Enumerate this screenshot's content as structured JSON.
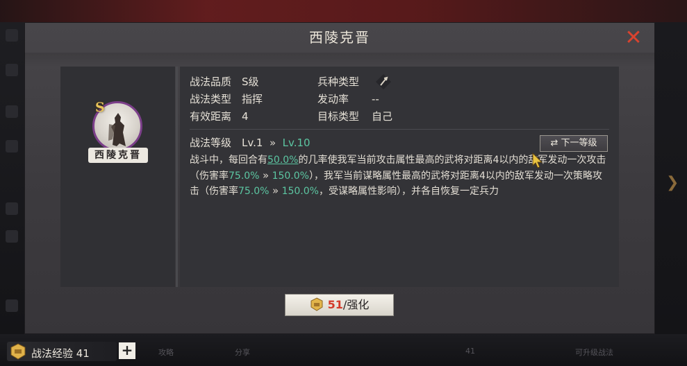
{
  "background": {
    "bottom_dim_texts": [
      "攻略",
      "分享",
      "可升级战法"
    ],
    "bottom_dim_number": "41"
  },
  "modal": {
    "title": "西陵克晋",
    "close_icon": "close-x-icon"
  },
  "tactic_card": {
    "rank": "S",
    "name": "西陵克晋",
    "border_color": "#7c3f8a"
  },
  "info": {
    "quality_label": "战法品质",
    "quality_value": "S级",
    "troop_label": "兵种类型",
    "troop_icon": "troop-type-icon",
    "type_label": "战法类型",
    "type_value": "指挥",
    "trigger_label": "发动率",
    "trigger_value": "--",
    "range_label": "有效距离",
    "range_value": "4",
    "target_label": "目标类型",
    "target_value": "自己"
  },
  "level": {
    "label": "战法等级",
    "current": "Lv.1",
    "arrow": "»",
    "next": "Lv.10",
    "next_button": "下一等级",
    "next_button_icon": "swap-arrows-icon"
  },
  "description": {
    "p1": "战斗中，每回合有",
    "chance": "50.0%",
    "p2": "的几率使我军当前攻击属性最高的武将对距离4以内的敌军发动一次攻击（伤害率",
    "dmg1_from": "75.0%",
    "arrow": "»",
    "dmg1_to": "150.0%",
    "p3": "），我军当前谋略属性最高的武将对距离4以内的敌军发动一次策略攻击（伤害率",
    "dmg2_from": "75.0%",
    "dmg2_to": "150.0%",
    "p4": "，受谋略属性影响），并各自恢复一定兵力"
  },
  "enhance": {
    "icon": "fist-scroll-icon",
    "count": "51",
    "label": "/强化"
  },
  "footer": {
    "exp_label": "战法经验 41",
    "exp_icon": "tactic-exp-icon",
    "plus": "+"
  },
  "colors": {
    "accent_green": "#5cc6a2",
    "close_red": "#d9432f",
    "count_red": "#d33a2a"
  }
}
